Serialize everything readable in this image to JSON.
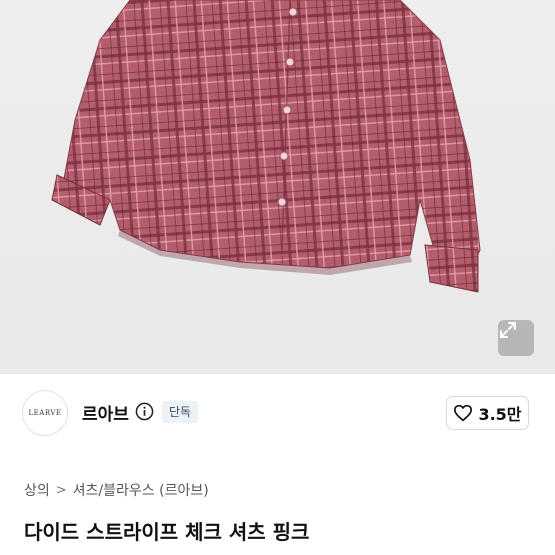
{
  "product": {
    "image_alt": "pink plaid check shirt",
    "colors": {
      "shirt": "#b45d6d",
      "check_dark": "#6e2a3a",
      "check_light": "#e7a3ae"
    }
  },
  "brand": {
    "logo_text": "LEARVE",
    "name": "르아브",
    "badge": "단독"
  },
  "likes": {
    "label": "3.5만"
  },
  "breadcrumb": {
    "items": [
      "상의",
      "셔츠/블라우스 (르아브)"
    ],
    "separator": ">"
  },
  "title": "다이드 스트라이프 체크 셔츠 핑크",
  "icons": {
    "expand": "expand-icon",
    "info": "info-icon",
    "heart": "heart-icon"
  }
}
